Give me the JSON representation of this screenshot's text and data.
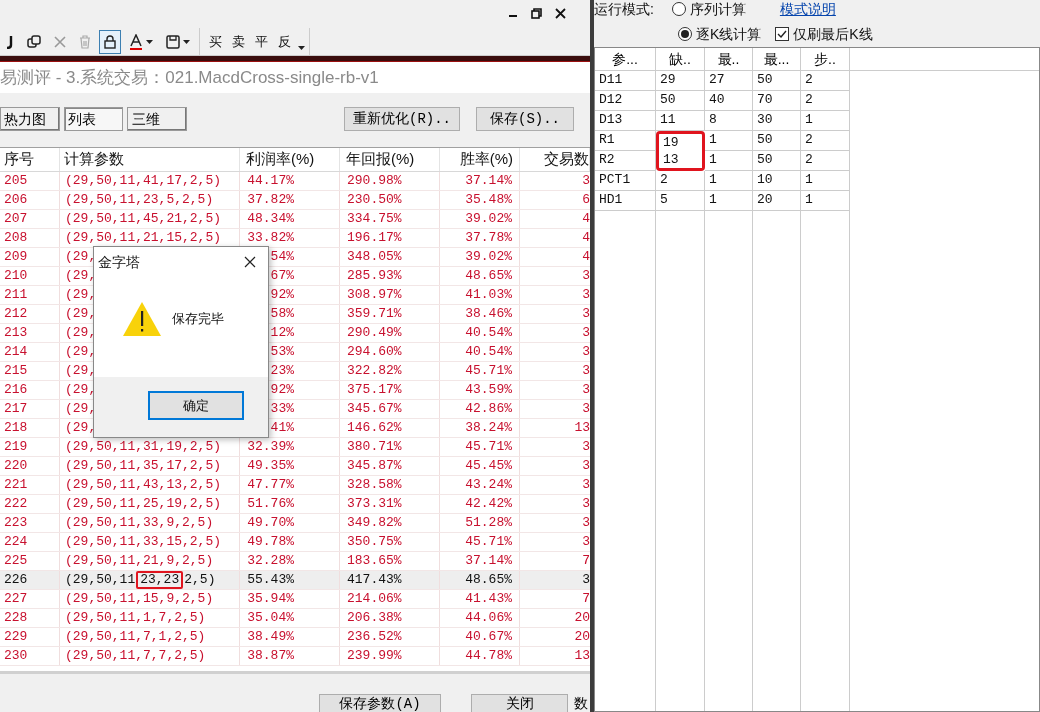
{
  "toolbar": {
    "buttons": [
      {
        "kind": "plain",
        "selected": false
      },
      {
        "kind": "plain",
        "selected": false
      },
      {
        "kind": "plain",
        "selected": false
      },
      {
        "kind": "plain",
        "selected": false
      },
      {
        "kind": "plain",
        "selected": true
      },
      {
        "kind": "dropdown",
        "selected": false
      },
      {
        "kind": "dropdown",
        "selected": false
      }
    ],
    "text_buttons": [
      "买",
      "卖",
      "平",
      "反"
    ]
  },
  "window": {
    "title": "易测评 - 3.系统交易：021.MacdCross-single-rb-v1"
  },
  "view_tabs": [
    {
      "label": "热力图",
      "selected": false
    },
    {
      "label": "列表",
      "selected": true
    },
    {
      "label": "三维",
      "selected": false
    }
  ],
  "actions": [
    "重新优化(R)..",
    "保存(S).."
  ],
  "table": {
    "columns": [
      "序号",
      "计算参数",
      "利润率(%)",
      "年回报(%)",
      "胜率(%)",
      "交易数"
    ],
    "rows": [
      {
        "id": "205",
        "params": "(29,50,11,41,17,2,5)",
        "profit": "44.17%",
        "annual": "290.98%",
        "win": "37.14%",
        "trades": "3",
        "selected": false
      },
      {
        "id": "206",
        "params": "(29,50,11,23,5,2,5)",
        "profit": "37.82%",
        "annual": "230.50%",
        "win": "35.48%",
        "trades": "6",
        "selected": false
      },
      {
        "id": "207",
        "params": "(29,50,11,45,21,2,5)",
        "profit": "48.34%",
        "annual": "334.75%",
        "win": "39.02%",
        "trades": "4",
        "selected": false
      },
      {
        "id": "208",
        "params": "(29,50,11,21,15,2,5)",
        "profit": "33.82%",
        "annual": "196.17%",
        "win": "37.78%",
        "trades": "4",
        "selected": false
      },
      {
        "id": "209",
        "params": "(29,",
        "profit": "54%",
        "annual": "348.05%",
        "win": "39.02%",
        "trades": "4",
        "selected": false
      },
      {
        "id": "210",
        "params": "(29,",
        "profit": "67%",
        "annual": "285.93%",
        "win": "48.65%",
        "trades": "3",
        "selected": false
      },
      {
        "id": "211",
        "params": "(29,",
        "profit": "92%",
        "annual": "308.97%",
        "win": "41.03%",
        "trades": "3",
        "selected": false
      },
      {
        "id": "212",
        "params": "(29,",
        "profit": "58%",
        "annual": "359.71%",
        "win": "38.46%",
        "trades": "3",
        "selected": false
      },
      {
        "id": "213",
        "params": "(29,",
        "profit": "12%",
        "annual": "290.49%",
        "win": "40.54%",
        "trades": "3",
        "selected": false
      },
      {
        "id": "214",
        "params": "(29,",
        "profit": "53%",
        "annual": "294.60%",
        "win": "40.54%",
        "trades": "3",
        "selected": false
      },
      {
        "id": "215",
        "params": "(29,",
        "profit": "23%",
        "annual": "322.82%",
        "win": "45.71%",
        "trades": "3",
        "selected": false
      },
      {
        "id": "216",
        "params": "(29,",
        "profit": "92%",
        "annual": "375.17%",
        "win": "43.59%",
        "trades": "3",
        "selected": false
      },
      {
        "id": "217",
        "params": "(29,",
        "profit": "33%",
        "annual": "345.67%",
        "win": "42.86%",
        "trades": "3",
        "selected": false
      },
      {
        "id": "218",
        "params": "(29,",
        "profit": "41%",
        "annual": "146.62%",
        "win": "38.24%",
        "trades": "13",
        "selected": false
      },
      {
        "id": "219",
        "params": "(29,50,11,31,19,2,5)",
        "profit": "32.39%",
        "annual": "380.71%",
        "win": "45.71%",
        "trades": "3",
        "selected": false
      },
      {
        "id": "220",
        "params": "(29,50,11,35,17,2,5)",
        "profit": "49.35%",
        "annual": "345.87%",
        "win": "45.45%",
        "trades": "3",
        "selected": false
      },
      {
        "id": "221",
        "params": "(29,50,11,43,13,2,5)",
        "profit": "47.77%",
        "annual": "328.58%",
        "win": "43.24%",
        "trades": "3",
        "selected": false
      },
      {
        "id": "222",
        "params": "(29,50,11,25,19,2,5)",
        "profit": "51.76%",
        "annual": "373.31%",
        "win": "42.42%",
        "trades": "3",
        "selected": false
      },
      {
        "id": "223",
        "params": "(29,50,11,33,9,2,5)",
        "profit": "49.70%",
        "annual": "349.82%",
        "win": "51.28%",
        "trades": "3",
        "selected": false
      },
      {
        "id": "224",
        "params": "(29,50,11,33,15,2,5)",
        "profit": "49.78%",
        "annual": "350.75%",
        "win": "45.71%",
        "trades": "3",
        "selected": false
      },
      {
        "id": "225",
        "params": "(29,50,11,21,9,2,5)",
        "profit": "32.28%",
        "annual": "183.65%",
        "win": "37.14%",
        "trades": "7",
        "selected": false
      },
      {
        "id": "226",
        "params": "(29,50,11",
        "marked": "23,23",
        "params_after": "2,5)",
        "profit": "55.43%",
        "annual": "417.43%",
        "win": "48.65%",
        "trades": "3",
        "selected": true
      },
      {
        "id": "227",
        "params": "(29,50,11,15,9,2,5)",
        "profit": "35.94%",
        "annual": "214.06%",
        "win": "41.43%",
        "trades": "7",
        "selected": false
      },
      {
        "id": "228",
        "params": "(29,50,11,1,7,2,5)",
        "profit": "35.04%",
        "annual": "206.38%",
        "win": "44.06%",
        "trades": "20",
        "selected": false
      },
      {
        "id": "229",
        "params": "(29,50,11,7,1,2,5)",
        "profit": "38.49%",
        "annual": "236.52%",
        "win": "40.67%",
        "trades": "20",
        "selected": false
      },
      {
        "id": "230",
        "params": "(29,50,11,7,7,2,5)",
        "profit": "38.87%",
        "annual": "239.99%",
        "win": "44.78%",
        "trades": "13",
        "selected": false
      }
    ]
  },
  "bottom_buttons": [
    "保存参数(A)",
    "关闭"
  ],
  "bottom_label": "数",
  "dialog": {
    "title": "金字塔",
    "message": "保存完毕",
    "button": "确定"
  },
  "run_mode": {
    "label": "运行模式:",
    "options": [
      {
        "label": "序列计算",
        "selected": false
      },
      {
        "label": "逐K线计算",
        "selected": true
      }
    ],
    "link": "模式说明",
    "checkbox": {
      "label": "仅刷最后K线",
      "checked": true
    }
  },
  "param_table": {
    "columns": [
      "参...",
      "缺..",
      "最..",
      "最...",
      "步.."
    ],
    "rows": [
      {
        "name": "D11",
        "default": "29",
        "min": "27",
        "max": "50",
        "step": "2",
        "marked": false
      },
      {
        "name": "D12",
        "default": "50",
        "min": "40",
        "max": "70",
        "step": "2",
        "marked": false
      },
      {
        "name": "D13",
        "default": "11",
        "min": "8",
        "max": "30",
        "step": "1",
        "marked": false
      },
      {
        "name": "R1",
        "default": "19",
        "min": "1",
        "max": "50",
        "step": "2",
        "marked": true
      },
      {
        "name": "R2",
        "default": "13",
        "min": "1",
        "max": "50",
        "step": "2",
        "marked": true
      },
      {
        "name": "PCT1",
        "default": "2",
        "min": "1",
        "max": "10",
        "step": "1",
        "marked": false
      },
      {
        "name": "HD1",
        "default": "5",
        "min": "1",
        "max": "20",
        "step": "1",
        "marked": false
      }
    ]
  }
}
